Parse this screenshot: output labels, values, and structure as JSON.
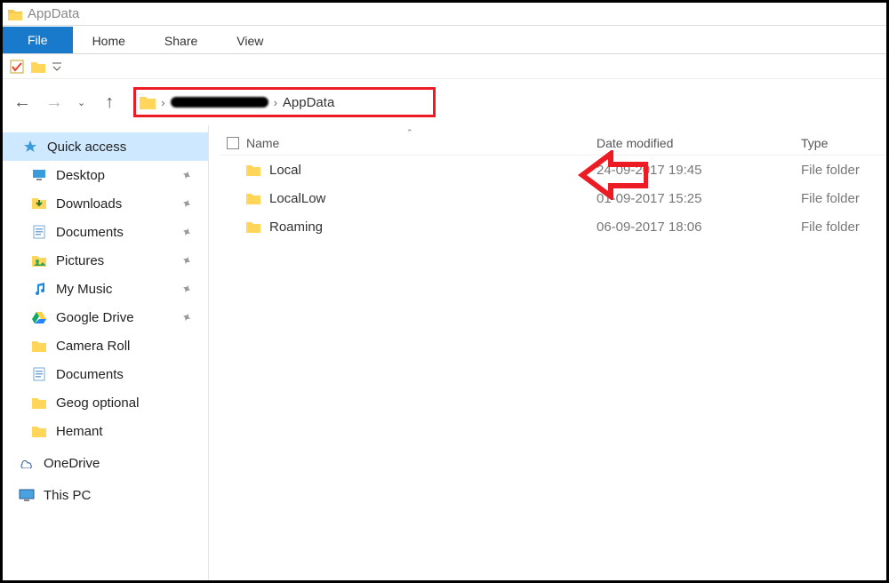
{
  "window": {
    "title": "AppData"
  },
  "ribbon": {
    "file": "File",
    "home": "Home",
    "share": "Share",
    "view": "View"
  },
  "breadcrumb": {
    "obscured": true,
    "current": "AppData"
  },
  "columns": {
    "name": "Name",
    "date": "Date modified",
    "type": "Type"
  },
  "sidebar": {
    "quick_access": "Quick access",
    "items": [
      {
        "label": "Desktop",
        "icon": "desktop",
        "pinned": true
      },
      {
        "label": "Downloads",
        "icon": "downloads",
        "pinned": true
      },
      {
        "label": "Documents",
        "icon": "documents",
        "pinned": true
      },
      {
        "label": "Pictures",
        "icon": "pictures",
        "pinned": true
      },
      {
        "label": "My Music",
        "icon": "music",
        "pinned": true
      },
      {
        "label": "Google Drive",
        "icon": "gdrive",
        "pinned": true
      },
      {
        "label": "Camera Roll",
        "icon": "folder",
        "pinned": false
      },
      {
        "label": "Documents",
        "icon": "documents",
        "pinned": false
      },
      {
        "label": "Geog optional",
        "icon": "folder",
        "pinned": false
      },
      {
        "label": "Hemant",
        "icon": "folder",
        "pinned": false
      }
    ],
    "onedrive": "OneDrive",
    "thispc": "This PC"
  },
  "files": [
    {
      "name": "Local",
      "date": "24-09-2017 19:45",
      "type": "File folder"
    },
    {
      "name": "LocalLow",
      "date": "01-09-2017 15:25",
      "type": "File folder"
    },
    {
      "name": "Roaming",
      "date": "06-09-2017 18:06",
      "type": "File folder"
    }
  ]
}
